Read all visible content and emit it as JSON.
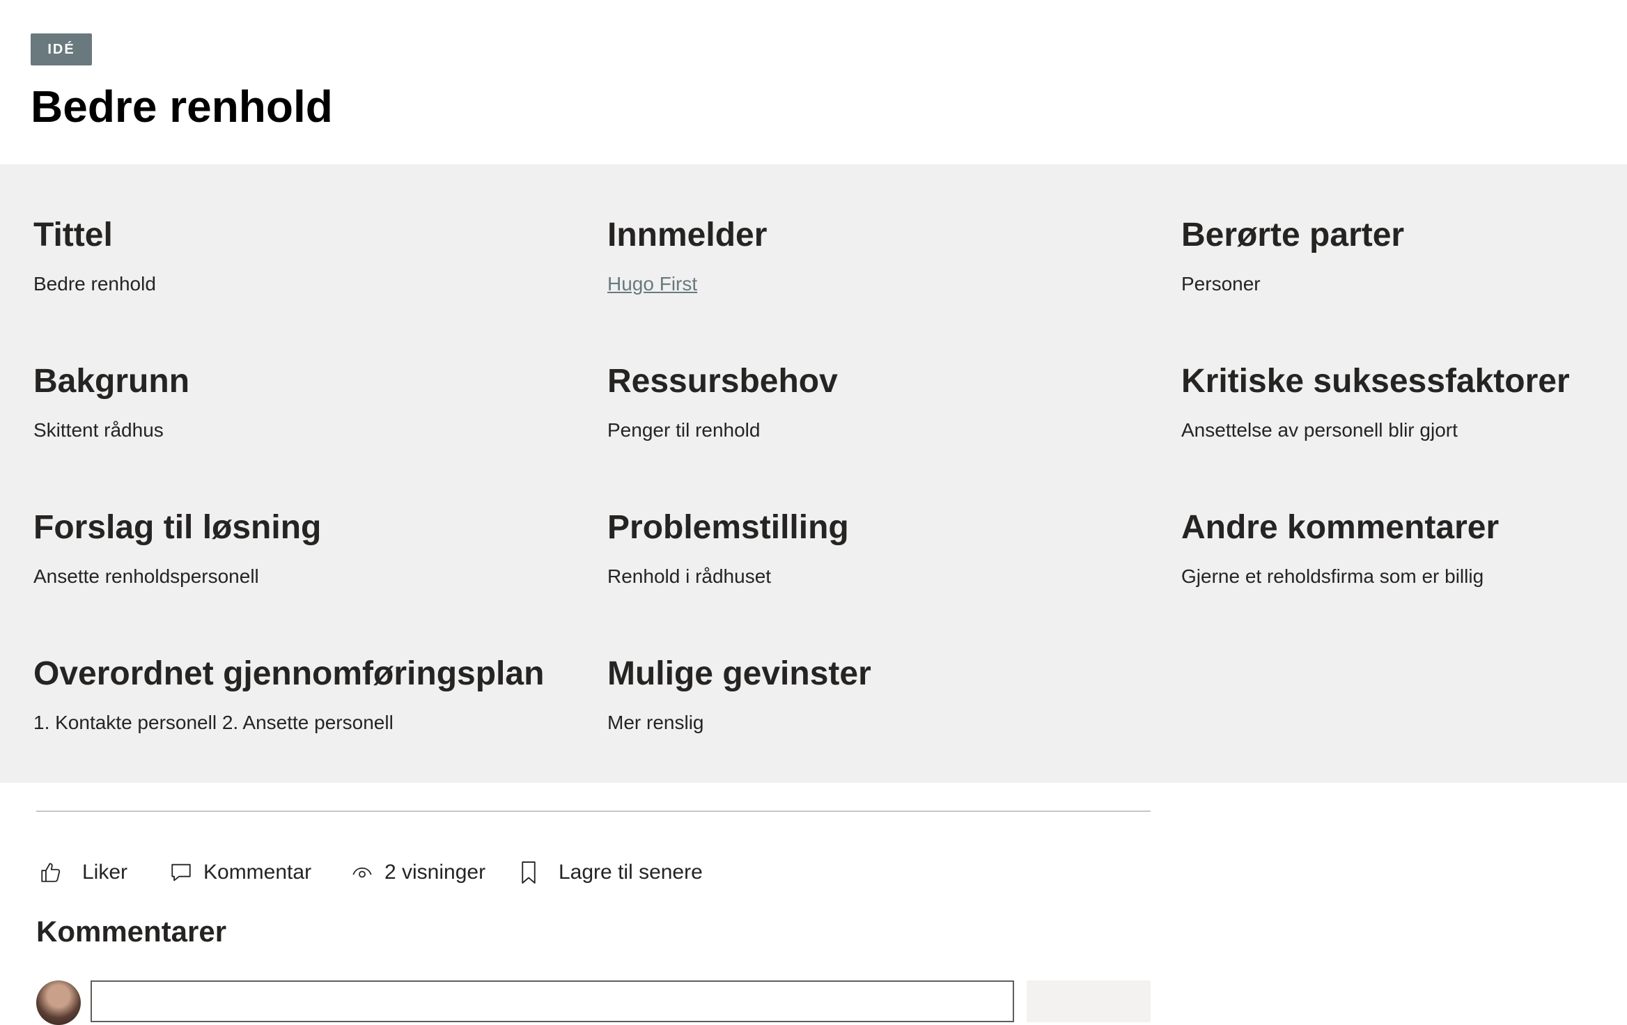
{
  "header": {
    "badge": "IDÉ",
    "title": "Bedre renhold"
  },
  "fields": [
    {
      "label": "Tittel",
      "value": "Bedre renhold"
    },
    {
      "label": "Innmelder",
      "value": "Hugo First"
    },
    {
      "label": "Berørte parter",
      "value": "Personer"
    },
    {
      "label": "Bakgrunn",
      "value": "Skittent rådhus"
    },
    {
      "label": "Ressursbehov",
      "value": "Penger til renhold"
    },
    {
      "label": "Kritiske suksessfaktorer",
      "value": "Ansettelse av personell blir gjort"
    },
    {
      "label": "Forslag til løsning",
      "value": "Ansette renholdspersonell"
    },
    {
      "label": "Problemstilling",
      "value": "Renhold i rådhuset"
    },
    {
      "label": "Andre kommentarer",
      "value": "Gjerne et reholdsfirma som er billig"
    },
    {
      "label": "Overordnet gjennomføringsplan",
      "value": "1. Kontakte personell 2. Ansette personell"
    },
    {
      "label": "Mulige gevinster",
      "value": "Mer renslig"
    }
  ],
  "actions": {
    "like": "Liker",
    "comment": "Kommentar",
    "views": "2 visninger",
    "save": "Lagre til senere"
  },
  "comments": {
    "title": "Kommentarer",
    "input_value": "",
    "post_label": ""
  },
  "icons": {
    "like": "thumbs-up-icon",
    "comment": "speech-bubble-icon",
    "views": "eye-icon",
    "save": "bookmark-icon"
  }
}
